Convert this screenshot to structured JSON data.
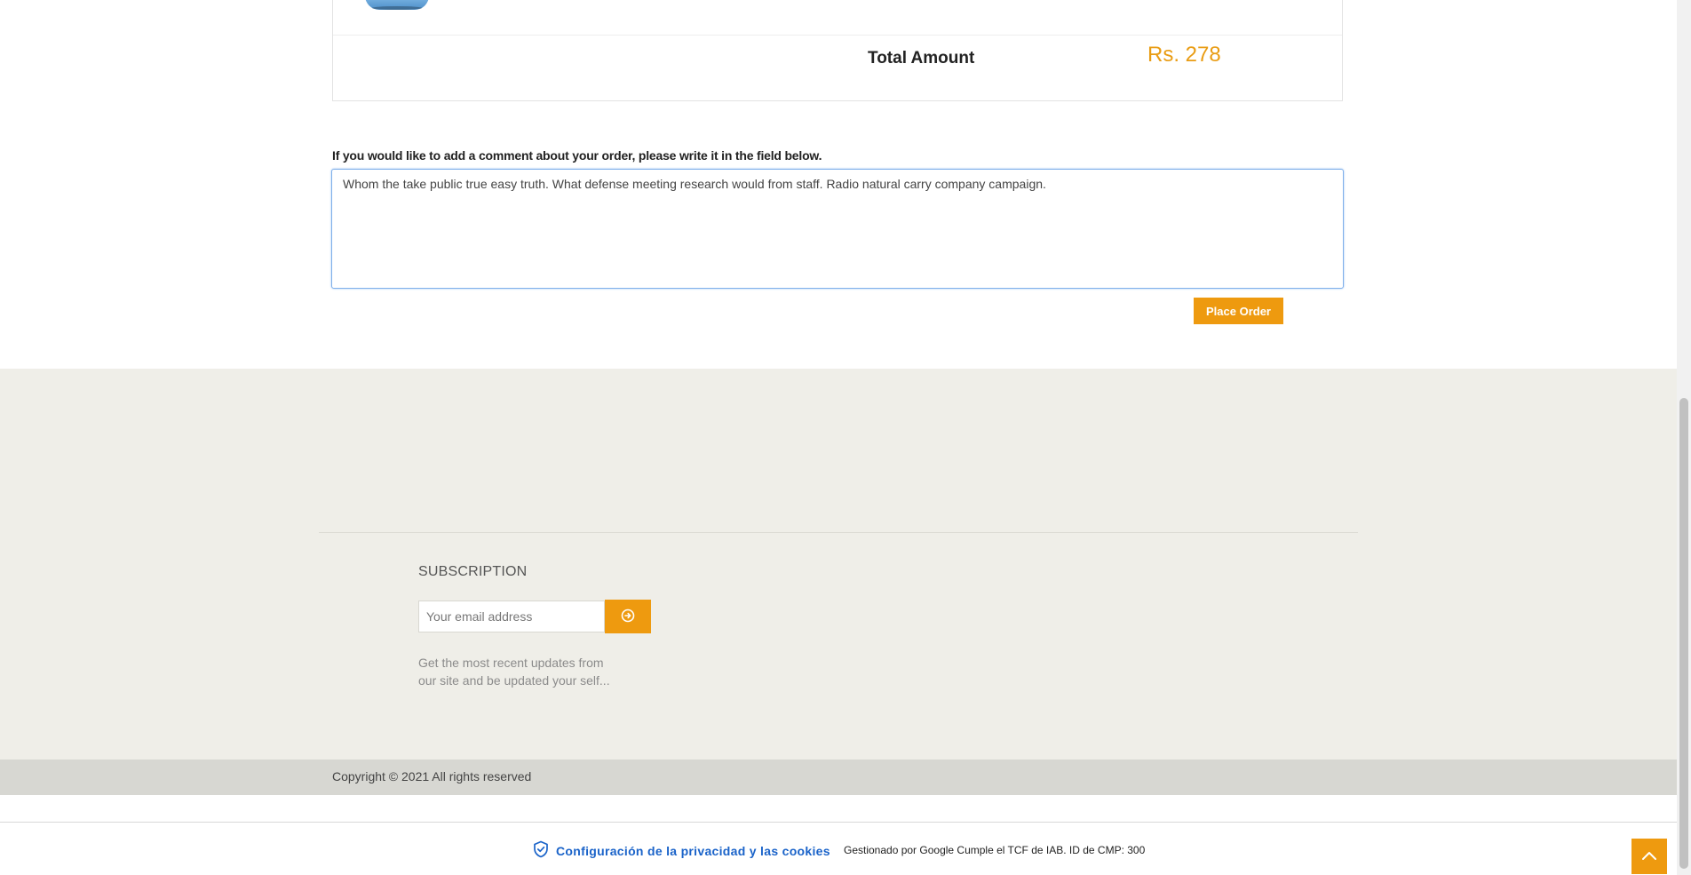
{
  "order_summary": {
    "total_label": "Total Amount",
    "total_value": "Rs. 278"
  },
  "comment": {
    "label": "If you would like to add a comment about your order, please write it in the field below.",
    "value": "Whom the take public true easy truth. What defense meeting research would from staff. Radio natural carry company campaign."
  },
  "actions": {
    "place_order_label": "Place Order"
  },
  "footer": {
    "subscription": {
      "title": "SUBSCRIPTION",
      "email_placeholder": "Your email address",
      "submit_icon": "arrow-circle-right-icon",
      "description": "Get the most recent updates from our site and be updated your self..."
    },
    "copyright": "Copyright © 2021 All rights reserved"
  },
  "consent": {
    "link_label": "Configuración de la privacidad y las cookies",
    "note": "Gestionado por Google Cumple el TCF de IAB. ID de CMP: 300",
    "icon": "shield-check-icon"
  },
  "scroll_top_icon": "chevron-up-icon",
  "colors": {
    "accent": "#ee9a0f",
    "total_price": "#e99c13",
    "footer_bg": "#efeee8",
    "copyright_bg": "#d7d7d2",
    "consent_link": "#1a63c9"
  }
}
